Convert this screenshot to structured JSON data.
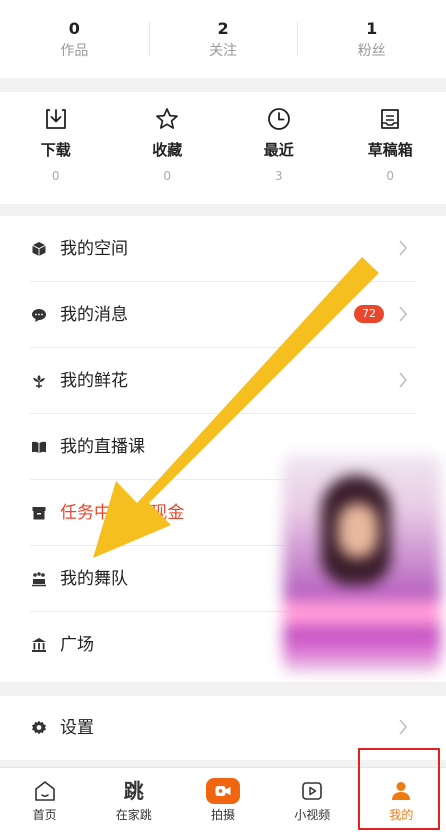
{
  "stats": [
    {
      "count": "0",
      "label": "作品"
    },
    {
      "count": "2",
      "label": "关注"
    },
    {
      "count": "1",
      "label": "粉丝"
    }
  ],
  "quick": [
    {
      "label": "下载",
      "count": "0",
      "icon": "download-icon"
    },
    {
      "label": "收藏",
      "count": "0",
      "icon": "star-icon"
    },
    {
      "label": "最近",
      "count": "3",
      "icon": "clock-icon"
    },
    {
      "label": "草稿箱",
      "count": "0",
      "icon": "draft-icon"
    }
  ],
  "menu": [
    {
      "label": "我的空间",
      "icon": "cube-icon"
    },
    {
      "label": "我的消息",
      "icon": "chat-bubble-icon",
      "badge": "72"
    },
    {
      "label": "我的鲜花",
      "icon": "flower-icon"
    },
    {
      "label": "我的直播课",
      "icon": "book-icon"
    },
    {
      "label": "任务中心 领现金",
      "icon": "task-box-icon",
      "highlight_color": "#e8472b"
    },
    {
      "label": "我的舞队",
      "icon": "dance-team-icon"
    },
    {
      "label": "广场",
      "icon": "plaza-icon"
    }
  ],
  "settings": {
    "label": "设置",
    "icon": "gear-icon"
  },
  "nav": [
    {
      "label": "首页",
      "icon": "home-icon"
    },
    {
      "label": "在家跳",
      "icon_text": "跳"
    },
    {
      "label": "拍摄",
      "icon": "camera-icon"
    },
    {
      "label": "小视频",
      "icon": "play-icon"
    },
    {
      "label": "我的",
      "icon": "person-icon",
      "active": true
    }
  ],
  "colors": {
    "accent": "#f07a12",
    "badge": "#e8472b",
    "arrow": "#f5bf1f",
    "highlight_box": "#e52020"
  }
}
